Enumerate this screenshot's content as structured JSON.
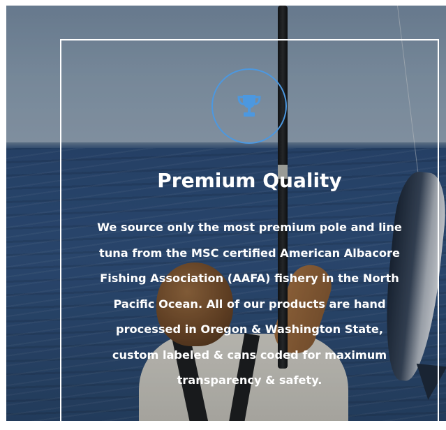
{
  "feature": {
    "icon": "trophy-icon",
    "accent_color": "#4c98e0",
    "title": "Premium Quality",
    "description": "We source only the most premium pole and line tuna from the MSC certified American Albacore Fishing Association (AAFA) fishery in the North Pacific Ocean. All of our products are hand processed in Oregon & Washington State, custom labeled & cans coded for maximum transparency & safety."
  }
}
